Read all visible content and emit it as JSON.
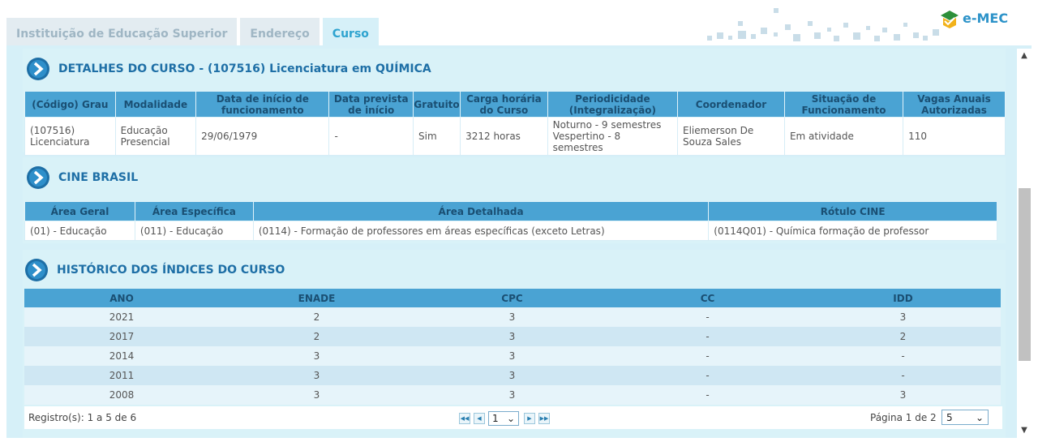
{
  "tabs": [
    {
      "label": "Instituição de Educação Superior",
      "active": false
    },
    {
      "label": "Endereço",
      "active": false
    },
    {
      "label": "Curso",
      "active": true
    }
  ],
  "logo": {
    "text": "e-MEC"
  },
  "detalhes": {
    "title": "DETALHES DO CURSO - (107516) Licenciatura em QUÍMICA",
    "headers": [
      "(Código) Grau",
      "Modalidade",
      "Data de início de funcionamento",
      "Data prevista de início",
      "Gratuito",
      "Carga horária do Curso",
      "Periodicidade (Integralização)",
      "Coordenador",
      "Situação de Funcionamento",
      "Vagas Anuais Autorizadas"
    ],
    "row": {
      "grau_l1": "(107516)",
      "grau_l2": "Licenciatura",
      "modalidade_l1": "Educação",
      "modalidade_l2": "Presencial",
      "data_inicio": "29/06/1979",
      "data_prevista": "-",
      "gratuito": "Sim",
      "carga": "3212 horas",
      "periodicidade_l1": "Noturno - 9 semestres",
      "periodicidade_l2": "Vespertino - 8 semestres",
      "coordenador_l1": "Eliemerson De",
      "coordenador_l2": "Souza Sales",
      "situacao": "Em atividade",
      "vagas": "110"
    }
  },
  "cine": {
    "title": "CINE BRASIL",
    "headers": [
      "Área Geral",
      "Área Específica",
      "Área Detalhada",
      "Rótulo CINE"
    ],
    "row": [
      "(01) - Educação",
      "(011) - Educação",
      "(0114) - Formação de professores em áreas específicas (exceto Letras)",
      "(0114Q01) - Química formação de professor"
    ]
  },
  "historico": {
    "title": "HISTÓRICO DOS ÍNDICES DO CURSO",
    "headers": [
      "ANO",
      "ENADE",
      "CPC",
      "CC",
      "IDD"
    ],
    "rows": [
      [
        "2021",
        "2",
        "3",
        "-",
        "3"
      ],
      [
        "2017",
        "2",
        "3",
        "-",
        "2"
      ],
      [
        "2014",
        "3",
        "3",
        "-",
        "-"
      ],
      [
        "2011",
        "3",
        "3",
        "-",
        "-"
      ],
      [
        "2008",
        "3",
        "3",
        "-",
        "3"
      ]
    ]
  },
  "pager": {
    "registros": "Registro(s): 1 a 5 de 6",
    "current_page": "1",
    "pagina": "Página 1 de 2",
    "page_size": "5"
  },
  "colors": {
    "accent": "#2ea3cf",
    "header": "#4aa3d3",
    "panel": "#d6f0f8",
    "title": "#1e6fa6"
  }
}
